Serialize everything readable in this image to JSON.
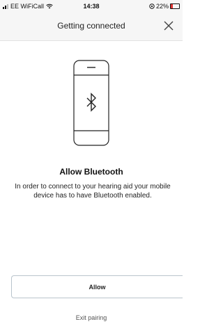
{
  "status_bar": {
    "carrier": "EE WiFiCall",
    "time": "14:38",
    "battery": "22%",
    "icons": [
      "signal-icon",
      "wifi-icon",
      "location-icon",
      "battery-icon"
    ]
  },
  "nav": {
    "title": "Getting connected",
    "close_icon": "close-icon"
  },
  "illustration": {
    "icon": "bluetooth-icon"
  },
  "content": {
    "heading": "Allow Bluetooth",
    "body": "In order to connect to your hearing aid your mobile device has to have Bluetooth enabled."
  },
  "actions": {
    "allow_label": "Allow",
    "exit_label": "Exit pairing"
  },
  "colors": {
    "button_border": "#b9c4cc",
    "battery_level": "#d33333"
  }
}
